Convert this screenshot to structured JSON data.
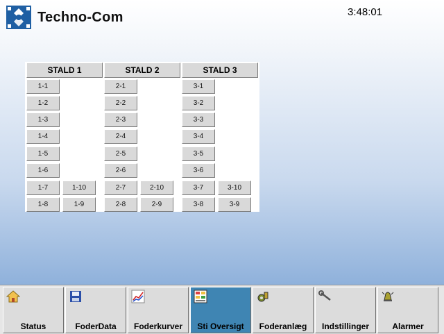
{
  "header": {
    "brand": "Techno-Com",
    "time": "3:48:01"
  },
  "stalde": [
    {
      "title": "STALD 1",
      "left_col": [
        "1-1",
        "1-2",
        "1-3",
        "1-4",
        "1-5",
        "1-6",
        "1-7",
        "1-8"
      ],
      "right_col": [
        "1-10",
        "1-9"
      ]
    },
    {
      "title": "STALD 2",
      "left_col": [
        "2-1",
        "2-2",
        "2-3",
        "2-4",
        "2-5",
        "2-6",
        "2-7",
        "2-8"
      ],
      "right_col": [
        "2-10",
        "2-9"
      ]
    },
    {
      "title": "STALD 3",
      "left_col": [
        "3-1",
        "3-2",
        "3-3",
        "3-4",
        "3-5",
        "3-6",
        "3-7",
        "3-8"
      ],
      "right_col": [
        "3-10",
        "3-9"
      ]
    }
  ],
  "nav": [
    {
      "label": "Status",
      "icon": "house-icon"
    },
    {
      "label": "FoderData",
      "icon": "floppy-disk-icon"
    },
    {
      "label": "Foderkurver",
      "icon": "line-chart-icon"
    },
    {
      "label": "Sti Oversigt",
      "icon": "pen-overview-icon",
      "active": true
    },
    {
      "label": "Foderanlæg",
      "icon": "feed-system-icon"
    },
    {
      "label": "Indstillinger",
      "icon": "wrench-icon"
    },
    {
      "label": "Alarmer",
      "icon": "alarm-bell-icon"
    }
  ],
  "colors": {
    "logo": "#1f5fa3",
    "active_tab": "#3f85b3",
    "button": "#d9d9d9"
  }
}
